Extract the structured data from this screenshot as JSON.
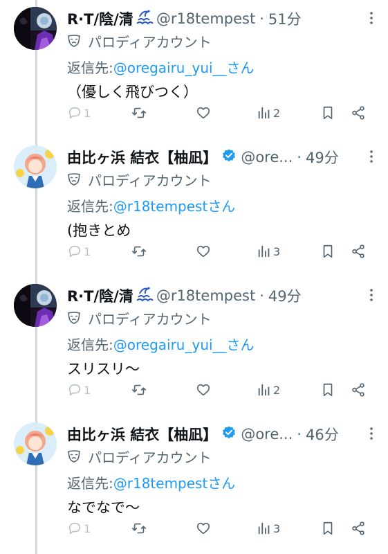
{
  "tweets": [
    {
      "author_name": "R·T/陰/清",
      "handle": "@r18tempest",
      "separator": "·",
      "time": "51分",
      "parody_label": "パロディアカウント",
      "reply_prefix": "返信先: ",
      "reply_to": "@oregairu_yui__さん",
      "text": "（優しく飛びつく）",
      "reply_count": "1",
      "views": "2",
      "verified": false,
      "avatar_style": "dark"
    },
    {
      "author_name": "由比ヶ浜 結衣【柚凪】",
      "handle": "@ore...",
      "separator": "·",
      "time": "49分",
      "parody_label": "パロディアカウント",
      "reply_prefix": "返信先: ",
      "reply_to": "@r18tempestさん",
      "text": "(抱きとめ",
      "reply_count": "1",
      "views": "3",
      "verified": true,
      "avatar_style": "anime"
    },
    {
      "author_name": "R·T/陰/清",
      "handle": "@r18tempest",
      "separator": "·",
      "time": "49分",
      "parody_label": "パロディアカウント",
      "reply_prefix": "返信先: ",
      "reply_to": "@oregairu_yui__さん",
      "text": "スリスリ〜",
      "reply_count": "1",
      "views": "2",
      "verified": false,
      "avatar_style": "dark"
    },
    {
      "author_name": "由比ヶ浜 結衣【柚凪】",
      "handle": "@ore...",
      "separator": "·",
      "time": "46分",
      "parody_label": "パロディアカウント",
      "reply_prefix": "返信先: ",
      "reply_to": "@r18tempestさん",
      "text": "なでなで〜",
      "reply_count": "1",
      "views": "3",
      "verified": true,
      "avatar_style": "anime"
    }
  ],
  "colors": {
    "text": "#0f1419",
    "muted": "#536471",
    "link": "#1d9bf0",
    "verified": "#1d9bf0",
    "thread_line": "#cfd9de"
  },
  "icons": [
    "more-icon",
    "parody-mask-icon",
    "verified-icon",
    "reply-icon",
    "retweet-icon",
    "like-icon",
    "views-icon",
    "bookmark-icon",
    "share-icon"
  ]
}
